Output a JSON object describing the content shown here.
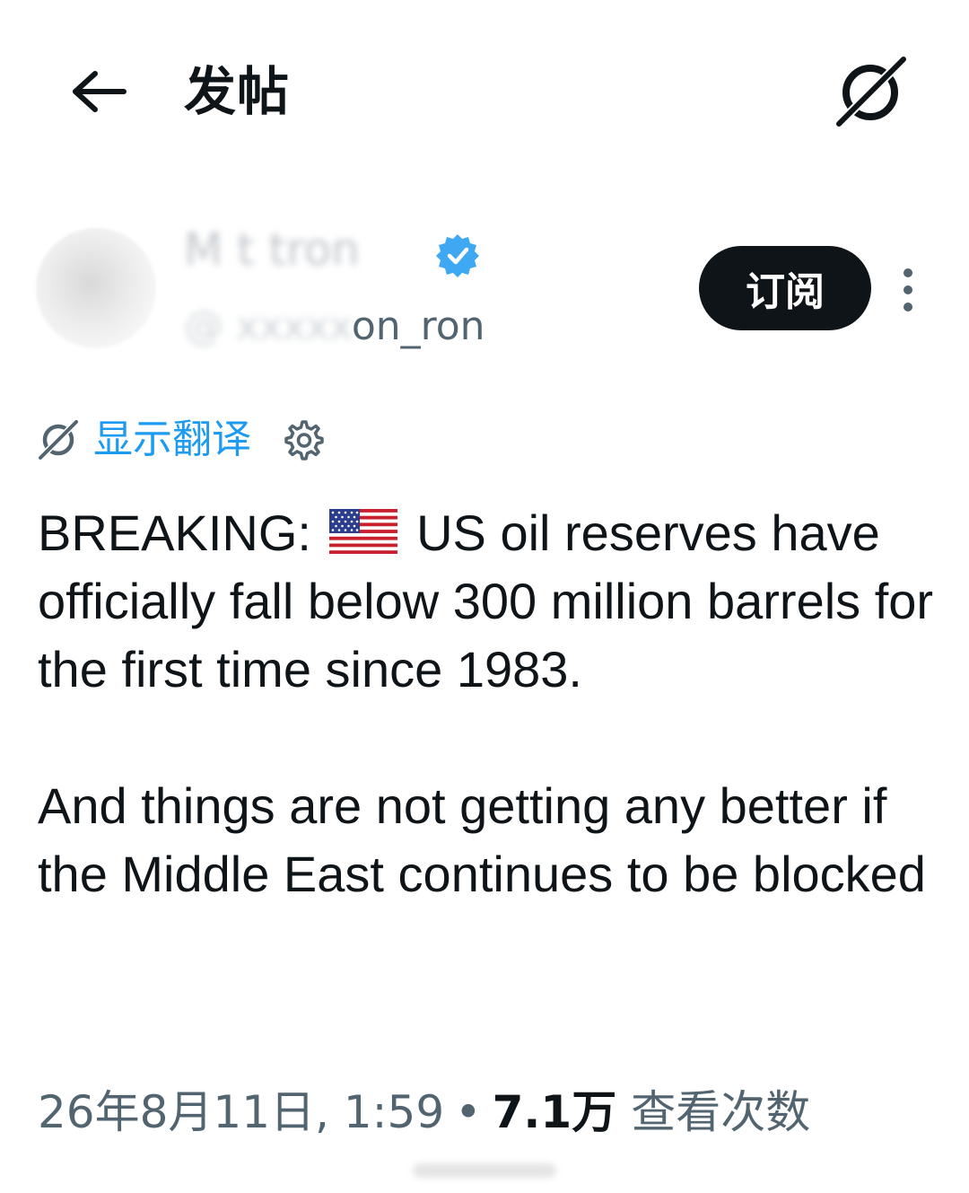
{
  "header": {
    "back_icon": "arrow-left-icon",
    "title": "发帖",
    "grok_icon": "grok-icon"
  },
  "author": {
    "display_name": "M  t  tron",
    "handle_blurred": "@",
    "handle_visible": "on_ron",
    "verified_color": "#1d9bf0",
    "subscribe_label": "订阅",
    "more_icon": "more-vertical-icon"
  },
  "translate": {
    "icon": "grok-icon",
    "label": "显示翻译",
    "settings_icon": "gear-icon"
  },
  "tweet": {
    "breaking_prefix": "BREAKING:",
    "flag_icon": "us-flag-icon",
    "line1_rest": "US oil reserves have officially fall below 300 million barrels for the first time since 1983.",
    "paragraph2": "And things are not getting any better if the Middle East continues to be blocked"
  },
  "meta": {
    "date": "26年8月11日, 1:59",
    "separator": "•",
    "views_count": "7.1万",
    "views_label": "查看次数"
  },
  "colors": {
    "accent": "#1d9bf0",
    "text_primary": "#0f1419",
    "text_secondary": "#536471",
    "button_bg": "#0f1419"
  }
}
